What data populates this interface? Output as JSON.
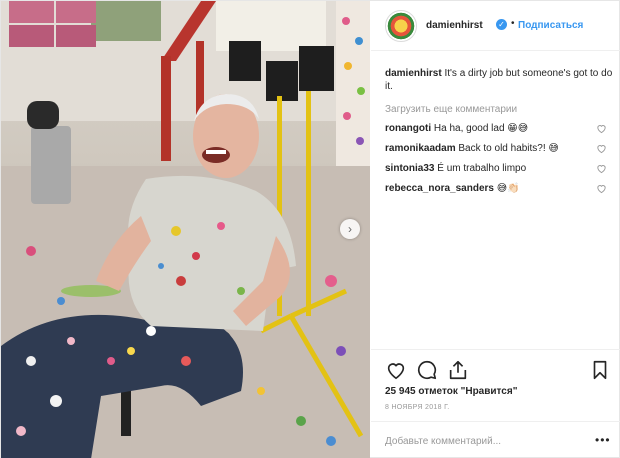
{
  "header": {
    "username": "damienhirst",
    "separator": "•",
    "follow_label": "Подписаться",
    "verified_mark": "✓"
  },
  "caption": {
    "username": "damienhirst",
    "text": "It's a dirty job but someone's got to do it."
  },
  "load_more_label": "Загрузить еще комментарии",
  "comments": [
    {
      "username": "ronangoti",
      "text": "Ha ha, good lad 😁😅"
    },
    {
      "username": "ramonikaadam",
      "text": "Back to old habits?! 😅"
    },
    {
      "username": "sintonia33",
      "text": "É um trabalho limpo"
    },
    {
      "username": "rebecca_nora_sanders",
      "text": "😅👏🏻"
    }
  ],
  "likes_text": "25 945 отметок \"Нравится\"",
  "date_text": "8 НОЯБРЯ 2018 Г.",
  "add_comment_placeholder": "Добавьте комментарий...",
  "more_label": "•••",
  "next_label": "›",
  "icons": {
    "like": "heart-icon",
    "comment": "comment-icon",
    "share": "share-icon",
    "save": "bookmark-icon",
    "comment_like": "heart-icon",
    "next": "chevron-right-icon",
    "verified": "verified-badge-icon"
  },
  "colors": {
    "link": "#3897f0",
    "muted": "#999999",
    "text": "#262626"
  }
}
